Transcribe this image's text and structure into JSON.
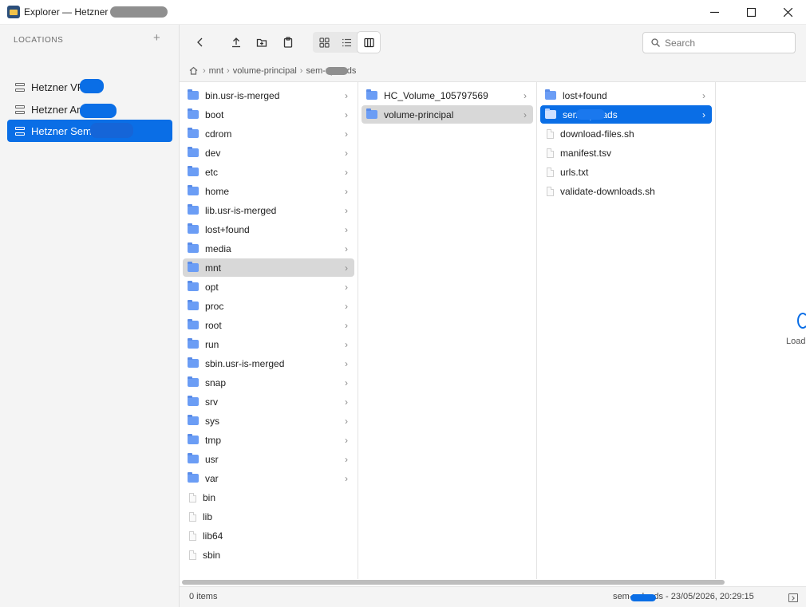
{
  "window": {
    "title": "Explorer — Hetzner S",
    "controls": {
      "minimize": "minimize-icon",
      "maximize": "maximize-icon",
      "close": "close-icon"
    }
  },
  "sidebar": {
    "header": "LOCATIONS",
    "add_label": "+",
    "items": [
      {
        "label": "Hetzner VP",
        "selected": false
      },
      {
        "label": "Hetzner Ar",
        "selected": false
      },
      {
        "label": "Hetzner Sem",
        "selected": true
      }
    ]
  },
  "toolbar": {
    "buttons": [
      "back-icon",
      "upload-icon",
      "new-folder-icon",
      "clipboard-icon"
    ],
    "views": [
      "grid-view-icon",
      "list-view-icon",
      "column-view-icon"
    ],
    "active_view": "column-view-icon",
    "search_placeholder": "Search"
  },
  "breadcrumb": {
    "items": [
      "mnt",
      "volume-principal",
      "sem-uploads"
    ]
  },
  "columns": {
    "col1": [
      {
        "name": "bin.usr-is-merged",
        "type": "folder"
      },
      {
        "name": "boot",
        "type": "folder"
      },
      {
        "name": "cdrom",
        "type": "folder"
      },
      {
        "name": "dev",
        "type": "folder"
      },
      {
        "name": "etc",
        "type": "folder"
      },
      {
        "name": "home",
        "type": "folder"
      },
      {
        "name": "lib.usr-is-merged",
        "type": "folder"
      },
      {
        "name": "lost+found",
        "type": "folder"
      },
      {
        "name": "media",
        "type": "folder"
      },
      {
        "name": "mnt",
        "type": "folder",
        "state": "open"
      },
      {
        "name": "opt",
        "type": "folder"
      },
      {
        "name": "proc",
        "type": "folder"
      },
      {
        "name": "root",
        "type": "folder"
      },
      {
        "name": "run",
        "type": "folder"
      },
      {
        "name": "sbin.usr-is-merged",
        "type": "folder"
      },
      {
        "name": "snap",
        "type": "folder"
      },
      {
        "name": "srv",
        "type": "folder"
      },
      {
        "name": "sys",
        "type": "folder"
      },
      {
        "name": "tmp",
        "type": "folder"
      },
      {
        "name": "usr",
        "type": "folder"
      },
      {
        "name": "var",
        "type": "folder"
      },
      {
        "name": "bin",
        "type": "file"
      },
      {
        "name": "lib",
        "type": "file"
      },
      {
        "name": "lib64",
        "type": "file"
      },
      {
        "name": "sbin",
        "type": "file"
      }
    ],
    "col2": [
      {
        "name": "HC_Volume_105797569",
        "type": "folder"
      },
      {
        "name": "volume-principal",
        "type": "folder",
        "state": "open"
      }
    ],
    "col3": [
      {
        "name": "lost+found",
        "type": "folder"
      },
      {
        "name": "sem-uploads",
        "type": "folder",
        "state": "selected"
      },
      {
        "name": "download-files.sh",
        "type": "file"
      },
      {
        "name": "manifest.tsv",
        "type": "file"
      },
      {
        "name": "urls.txt",
        "type": "file"
      },
      {
        "name": "validate-downloads.sh",
        "type": "file"
      }
    ]
  },
  "preview": {
    "loading_label": "Load"
  },
  "status": {
    "items_count": "0 items",
    "selection_info": "sem-uploads - 23/05/2026, 20:29:15",
    "terminal_icon": "terminal-icon"
  },
  "colors": {
    "accent": "#0a6ee6",
    "folder": "#6b9df5",
    "open_row": "#d8d8d8"
  }
}
